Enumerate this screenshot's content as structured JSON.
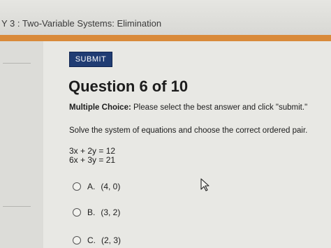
{
  "header": {
    "title": "Y 3 : Two-Variable Systems: Elimination"
  },
  "actions": {
    "submit_label": "SUBMIT"
  },
  "question": {
    "title": "Question 6 of 10",
    "type_label": "Multiple Choice:",
    "instruction": "Please select the best answer and click \"submit.\"",
    "prompt": "Solve the system of equations and choose the correct ordered pair.",
    "equations": [
      "3x + 2y = 12",
      "6x + 3y = 21"
    ]
  },
  "options": [
    {
      "letter": "A.",
      "value": "(4, 0)"
    },
    {
      "letter": "B.",
      "value": "(3, 2)"
    },
    {
      "letter": "C.",
      "value": "(2, 3)"
    }
  ],
  "colors": {
    "accent_strip": "#d98a3a",
    "button_bg": "#203c73"
  },
  "icons": {
    "pointer": "mouse-pointer-icon",
    "radio": "radio-icon"
  }
}
